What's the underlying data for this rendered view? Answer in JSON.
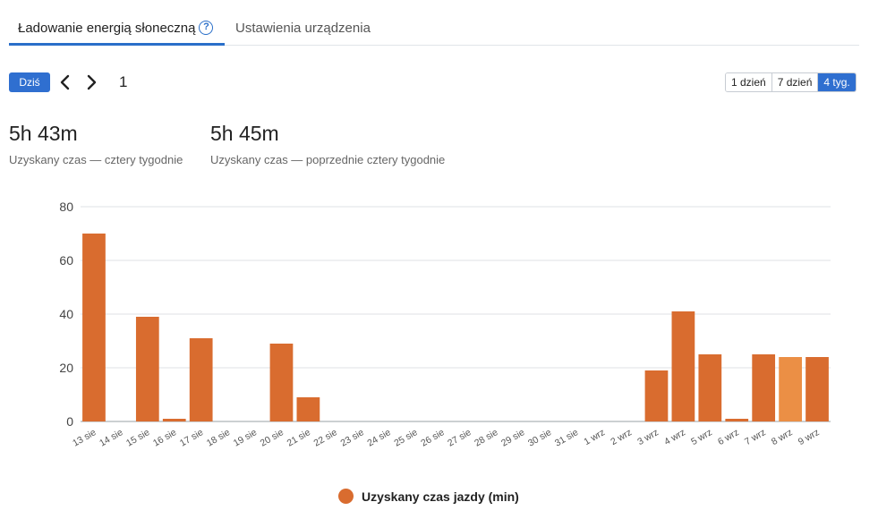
{
  "tabs": {
    "active": "Ładowanie energią słoneczną",
    "inactive": "Ustawienia urządzenia",
    "help_icon": "?"
  },
  "toolbar": {
    "today_label": "Dziś",
    "page_number": "1",
    "ranges": [
      "1 dzień",
      "7 dzień",
      "4 tyg."
    ],
    "selected_range": "4 tyg."
  },
  "stats": {
    "current_value": "5h 43m",
    "current_label": "Uzyskany czas — cztery tygodnie",
    "previous_value": "5h 45m",
    "previous_label": "Uzyskany czas — poprzednie cztery tygodnie"
  },
  "chart_data": {
    "type": "bar",
    "categories": [
      "13 sie",
      "14 sie",
      "15 sie",
      "16 sie",
      "17 sie",
      "18 sie",
      "19 sie",
      "20 sie",
      "21 sie",
      "22 sie",
      "23 sie",
      "24 sie",
      "25 sie",
      "26 sie",
      "27 sie",
      "28 sie",
      "29 sie",
      "30 sie",
      "31 sie",
      "1 wrz",
      "2 wrz",
      "3 wrz",
      "4 wrz",
      "5 wrz",
      "6 wrz",
      "7 wrz",
      "8 wrz",
      "9 wrz"
    ],
    "series": [
      {
        "name": "Uzyskany czas jazdy (min)",
        "values": [
          70,
          0,
          39,
          1,
          31,
          0,
          0,
          29,
          9,
          0,
          0,
          0,
          0,
          0,
          0,
          0,
          0,
          0,
          0,
          0,
          0,
          19,
          41,
          25,
          1,
          25,
          24,
          24
        ]
      }
    ],
    "yticks": [
      0,
      20,
      40,
      60,
      80
    ],
    "ylim": [
      0,
      80
    ],
    "highlight_index": 26,
    "grid": true,
    "legend_position": "bottom",
    "colors": {
      "bar": "#d96c2f",
      "bar_highlight": "#eb8f45"
    }
  }
}
